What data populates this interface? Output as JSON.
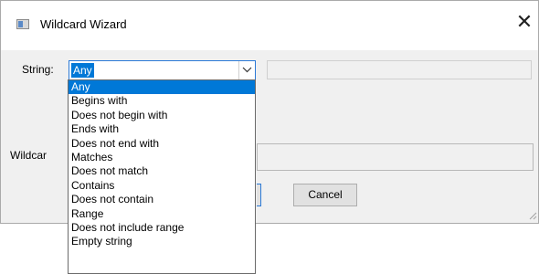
{
  "window": {
    "title": "Wildcard Wizard",
    "close_glyph": "✕"
  },
  "form": {
    "string_label": "String:",
    "selected_value": "Any",
    "wildcard_label": "Wildcar"
  },
  "dropdown": {
    "options": [
      "Any",
      "Begins with",
      "Does not begin with",
      "Ends with",
      "Does not end with",
      "Matches",
      "Does not match",
      "Contains",
      "Does not contain",
      "Range",
      "Does not include range",
      "Empty string"
    ],
    "selected_index": 0
  },
  "buttons": {
    "cancel": "Cancel"
  },
  "colors": {
    "selection": "#0078d7",
    "focus_border": "#2c7ad6",
    "dialog_bg": "#f0f0f0"
  },
  "icons": [
    "app-icon",
    "close-icon",
    "chevron-down-icon",
    "resize-grip-icon"
  ]
}
